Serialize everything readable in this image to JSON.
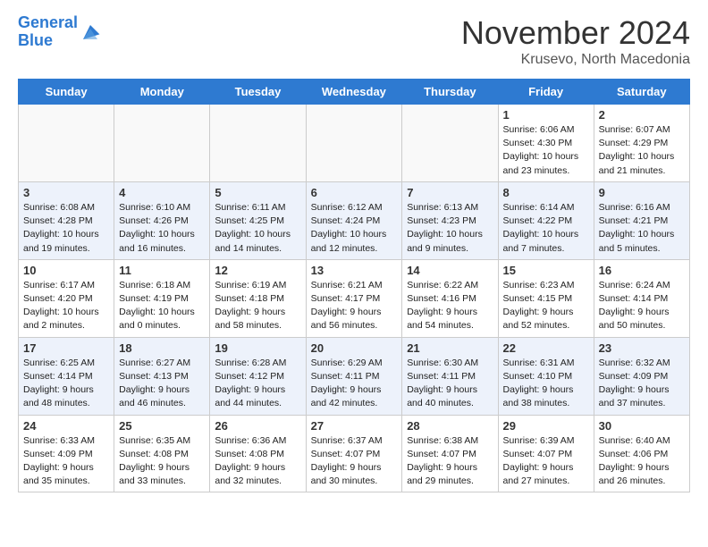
{
  "header": {
    "logo_line1": "General",
    "logo_line2": "Blue",
    "month_title": "November 2024",
    "location": "Krusevo, North Macedonia"
  },
  "days_of_week": [
    "Sunday",
    "Monday",
    "Tuesday",
    "Wednesday",
    "Thursday",
    "Friday",
    "Saturday"
  ],
  "weeks": [
    [
      {
        "day": "",
        "info": ""
      },
      {
        "day": "",
        "info": ""
      },
      {
        "day": "",
        "info": ""
      },
      {
        "day": "",
        "info": ""
      },
      {
        "day": "",
        "info": ""
      },
      {
        "day": "1",
        "info": "Sunrise: 6:06 AM\nSunset: 4:30 PM\nDaylight: 10 hours and 23 minutes."
      },
      {
        "day": "2",
        "info": "Sunrise: 6:07 AM\nSunset: 4:29 PM\nDaylight: 10 hours and 21 minutes."
      }
    ],
    [
      {
        "day": "3",
        "info": "Sunrise: 6:08 AM\nSunset: 4:28 PM\nDaylight: 10 hours and 19 minutes."
      },
      {
        "day": "4",
        "info": "Sunrise: 6:10 AM\nSunset: 4:26 PM\nDaylight: 10 hours and 16 minutes."
      },
      {
        "day": "5",
        "info": "Sunrise: 6:11 AM\nSunset: 4:25 PM\nDaylight: 10 hours and 14 minutes."
      },
      {
        "day": "6",
        "info": "Sunrise: 6:12 AM\nSunset: 4:24 PM\nDaylight: 10 hours and 12 minutes."
      },
      {
        "day": "7",
        "info": "Sunrise: 6:13 AM\nSunset: 4:23 PM\nDaylight: 10 hours and 9 minutes."
      },
      {
        "day": "8",
        "info": "Sunrise: 6:14 AM\nSunset: 4:22 PM\nDaylight: 10 hours and 7 minutes."
      },
      {
        "day": "9",
        "info": "Sunrise: 6:16 AM\nSunset: 4:21 PM\nDaylight: 10 hours and 5 minutes."
      }
    ],
    [
      {
        "day": "10",
        "info": "Sunrise: 6:17 AM\nSunset: 4:20 PM\nDaylight: 10 hours and 2 minutes."
      },
      {
        "day": "11",
        "info": "Sunrise: 6:18 AM\nSunset: 4:19 PM\nDaylight: 10 hours and 0 minutes."
      },
      {
        "day": "12",
        "info": "Sunrise: 6:19 AM\nSunset: 4:18 PM\nDaylight: 9 hours and 58 minutes."
      },
      {
        "day": "13",
        "info": "Sunrise: 6:21 AM\nSunset: 4:17 PM\nDaylight: 9 hours and 56 minutes."
      },
      {
        "day": "14",
        "info": "Sunrise: 6:22 AM\nSunset: 4:16 PM\nDaylight: 9 hours and 54 minutes."
      },
      {
        "day": "15",
        "info": "Sunrise: 6:23 AM\nSunset: 4:15 PM\nDaylight: 9 hours and 52 minutes."
      },
      {
        "day": "16",
        "info": "Sunrise: 6:24 AM\nSunset: 4:14 PM\nDaylight: 9 hours and 50 minutes."
      }
    ],
    [
      {
        "day": "17",
        "info": "Sunrise: 6:25 AM\nSunset: 4:14 PM\nDaylight: 9 hours and 48 minutes."
      },
      {
        "day": "18",
        "info": "Sunrise: 6:27 AM\nSunset: 4:13 PM\nDaylight: 9 hours and 46 minutes."
      },
      {
        "day": "19",
        "info": "Sunrise: 6:28 AM\nSunset: 4:12 PM\nDaylight: 9 hours and 44 minutes."
      },
      {
        "day": "20",
        "info": "Sunrise: 6:29 AM\nSunset: 4:11 PM\nDaylight: 9 hours and 42 minutes."
      },
      {
        "day": "21",
        "info": "Sunrise: 6:30 AM\nSunset: 4:11 PM\nDaylight: 9 hours and 40 minutes."
      },
      {
        "day": "22",
        "info": "Sunrise: 6:31 AM\nSunset: 4:10 PM\nDaylight: 9 hours and 38 minutes."
      },
      {
        "day": "23",
        "info": "Sunrise: 6:32 AM\nSunset: 4:09 PM\nDaylight: 9 hours and 37 minutes."
      }
    ],
    [
      {
        "day": "24",
        "info": "Sunrise: 6:33 AM\nSunset: 4:09 PM\nDaylight: 9 hours and 35 minutes."
      },
      {
        "day": "25",
        "info": "Sunrise: 6:35 AM\nSunset: 4:08 PM\nDaylight: 9 hours and 33 minutes."
      },
      {
        "day": "26",
        "info": "Sunrise: 6:36 AM\nSunset: 4:08 PM\nDaylight: 9 hours and 32 minutes."
      },
      {
        "day": "27",
        "info": "Sunrise: 6:37 AM\nSunset: 4:07 PM\nDaylight: 9 hours and 30 minutes."
      },
      {
        "day": "28",
        "info": "Sunrise: 6:38 AM\nSunset: 4:07 PM\nDaylight: 9 hours and 29 minutes."
      },
      {
        "day": "29",
        "info": "Sunrise: 6:39 AM\nSunset: 4:07 PM\nDaylight: 9 hours and 27 minutes."
      },
      {
        "day": "30",
        "info": "Sunrise: 6:40 AM\nSunset: 4:06 PM\nDaylight: 9 hours and 26 minutes."
      }
    ]
  ]
}
